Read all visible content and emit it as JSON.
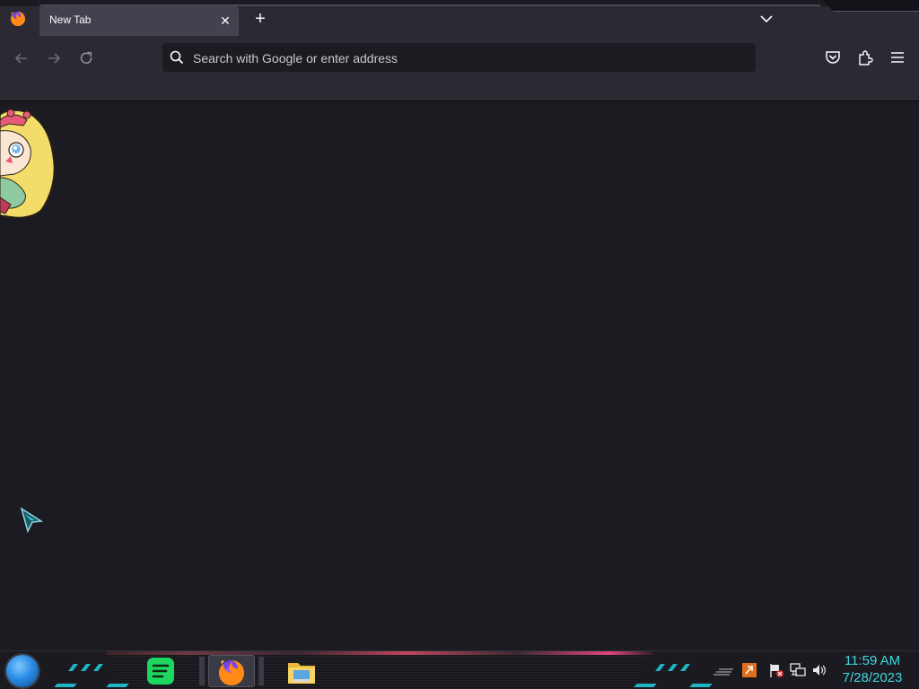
{
  "browser": {
    "tabs": [
      {
        "label": "New Tab",
        "active": true
      }
    ],
    "urlbar": {
      "placeholder": "Search with Google or enter address",
      "value": ""
    },
    "colors": {
      "chrome": "#2b2a33",
      "content": "#1c1b22",
      "active_tab": "#42414d",
      "text": "#fbfbfe"
    }
  },
  "toolbar": {
    "icons": [
      "back-icon",
      "forward-icon",
      "reload-icon",
      "pocket-icon",
      "extensions-icon",
      "menu-icon"
    ]
  },
  "taskbar": {
    "apps": [
      {
        "name": "spotify",
        "active": false
      },
      {
        "name": "firefox",
        "active": true
      },
      {
        "name": "file-explorer",
        "active": false
      }
    ],
    "tray_icons": [
      "show-hidden-icons-icon",
      "app-tray-icon",
      "action-center-flag-icon",
      "network-icon",
      "volume-icon"
    ],
    "clock": {
      "time": "11:59 AM",
      "date": "7/28/2023"
    },
    "colors": {
      "accent": "#1fb5c4",
      "clock_text": "#3fd7e0"
    }
  }
}
